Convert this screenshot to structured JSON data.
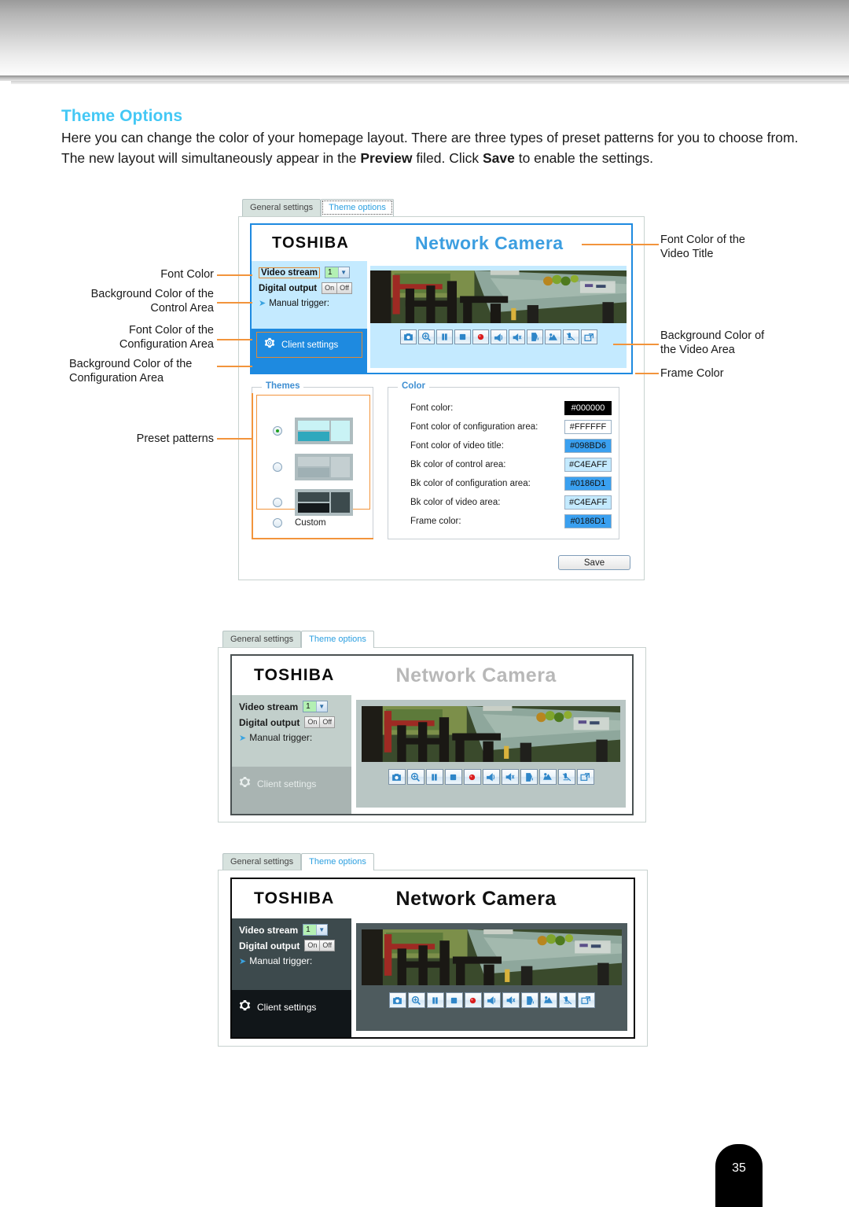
{
  "page": {
    "section_title": "Theme Options",
    "paragraph_1": "Here you can change the color of your homepage layout. There are three types of preset patterns for you to choose from. The new layout will simultaneously appear in the ",
    "paragraph_bold_1": "Preview",
    "paragraph_2": " filed. Click ",
    "paragraph_bold_2": "Save",
    "paragraph_3": " to enable the settings.",
    "page_number": "35"
  },
  "tabs": {
    "general_settings": "General settings",
    "theme_options": "Theme options"
  },
  "camera": {
    "logo": "TOSHIBA",
    "title": "Network Camera",
    "video_stream_label": "Video stream",
    "video_stream_value": "1",
    "digital_output_label": "Digital output",
    "digital_output_on": "On",
    "digital_output_off": "Off",
    "manual_trigger_label": "Manual trigger:",
    "client_settings_label": "Client settings",
    "control_icons": [
      "snapshot-icon",
      "digital-zoom-icon",
      "pause-icon",
      "stop-icon",
      "record-icon",
      "volume-icon",
      "mute-icon",
      "talk-icon",
      "listen-icon",
      "mic-off-icon",
      "fullscreen-icon"
    ]
  },
  "themes_panel": {
    "legend": "Themes",
    "options": [
      {
        "id": "preset-blue",
        "selected": true,
        "label": ""
      },
      {
        "id": "preset-gray",
        "selected": false,
        "label": ""
      },
      {
        "id": "preset-dark",
        "selected": false,
        "label": ""
      },
      {
        "id": "custom",
        "selected": false,
        "label": "Custom"
      }
    ]
  },
  "color_panel": {
    "legend": "Color",
    "rows": [
      {
        "label": "Font color:",
        "value": "#000000",
        "bg": "#000000",
        "fg": "#ffffff"
      },
      {
        "label": "Font color of configuration area:",
        "value": "#FFFFFF",
        "bg": "#ffffff",
        "fg": "#111111"
      },
      {
        "label": "Font color of video title:",
        "value": "#098BD6",
        "bg": "#3aa0f0",
        "fg": "#111111"
      },
      {
        "label": "Bk color of control area:",
        "value": "#C4EAFF",
        "bg": "#c4eaff",
        "fg": "#111111"
      },
      {
        "label": "Bk color of configuration area:",
        "value": "#0186D1",
        "bg": "#3aa0f0",
        "fg": "#111111"
      },
      {
        "label": "Bk color of video area:",
        "value": "#C4EAFF",
        "bg": "#c4eaff",
        "fg": "#111111"
      },
      {
        "label": "Frame color:",
        "value": "#0186D1",
        "bg": "#3aa0f0",
        "fg": "#111111"
      }
    ]
  },
  "save_button": {
    "label": "Save"
  },
  "callouts": {
    "font_color": "Font Color",
    "bk_control_area": "Background Color of the\nControl Area",
    "font_config_area": "Font Color of the\nConfiguration Area",
    "bk_config_area": "Background Color of the\nConfiguration Area",
    "preset_patterns": "Preset patterns",
    "font_video_title": "Font Color of the\nVideo Title",
    "bk_video_area": "Background Color of\nthe Video Area",
    "frame_color": "Frame Color"
  },
  "preview_themes": [
    {
      "name": "blue-theme",
      "title_color": "#3c9ee0",
      "config_bg": "#c4eaff",
      "client_bg": "#1e8ae0",
      "client_fg": "#ffffff",
      "video_bg": "#c4eaff",
      "frame_color": "#1e8ae0",
      "label_color": "#111111"
    },
    {
      "name": "gray-theme",
      "title_color": "#b8b8b8",
      "config_bg": "#c2cfcb",
      "client_bg": "#a9b4b2",
      "client_fg": "#e6eceb",
      "video_bg": "#b9c6c4",
      "frame_color": "#4a5152",
      "label_color": "#1a1a1a"
    },
    {
      "name": "dark-theme",
      "title_color": "#111111",
      "config_bg": "#3d4a4d",
      "client_bg": "#111619",
      "client_fg": "#ffffff",
      "video_bg": "#4e5b5e",
      "frame_color": "#0a0a0a",
      "label_color": "#ffffff"
    }
  ]
}
